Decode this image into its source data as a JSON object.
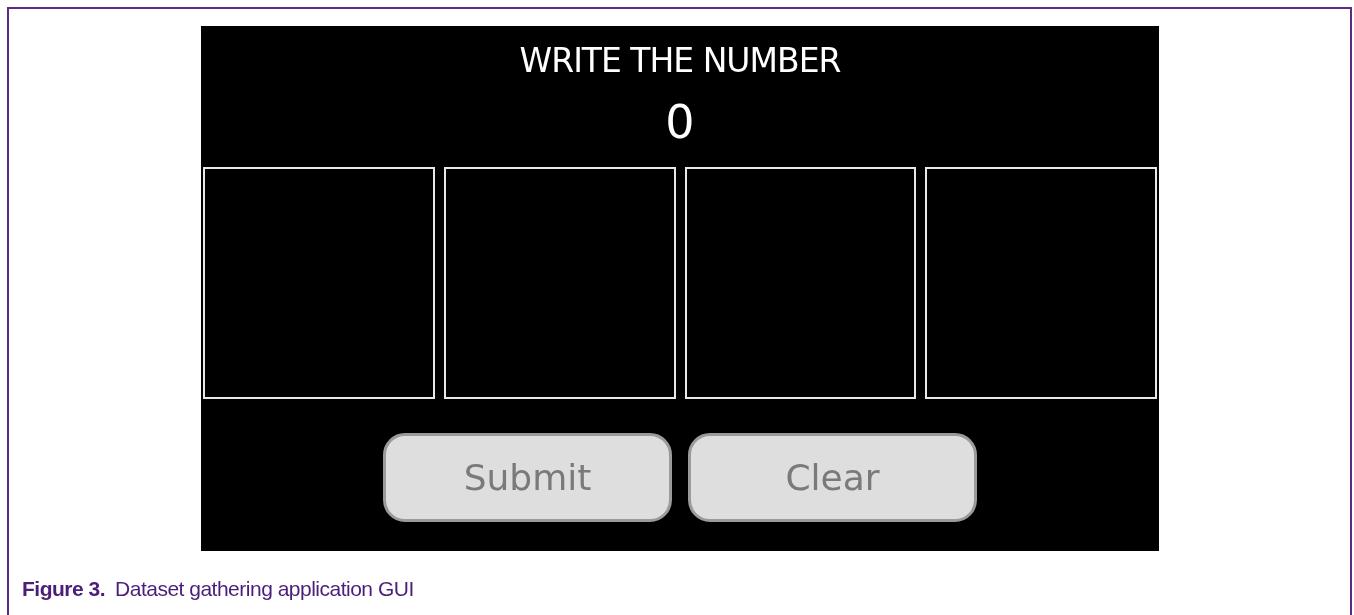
{
  "screen": {
    "title": "WRITE THE NUMBER",
    "number": "0",
    "draw_pads": [
      {
        "kind": "pad"
      },
      {
        "kind": "pad"
      },
      {
        "kind": "pad"
      },
      {
        "kind": "pad"
      }
    ],
    "buttons": [
      "Submit",
      "Clear"
    ]
  },
  "caption": {
    "label": "Figure 3.",
    "text": "Dataset gathering application GUI"
  }
}
